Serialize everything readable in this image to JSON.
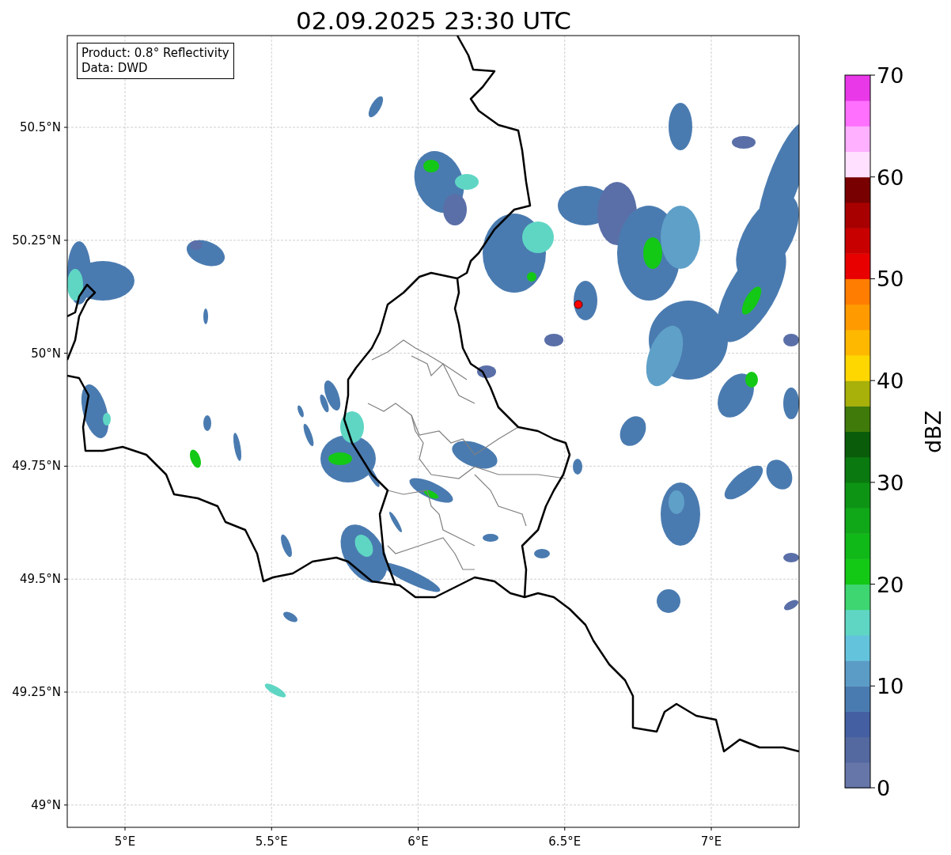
{
  "title": "02.09.2025 23:30 UTC",
  "info_box": {
    "lines": [
      "Product: 0.8° Reflectivity",
      "Data: DWD"
    ]
  },
  "map": {
    "y_ticks": [
      "50.5°N",
      "50.25°N",
      "50°N",
      "49.75°N",
      "49.5°N",
      "49.25°N",
      "49°N"
    ],
    "x_ticks": [
      "5°E",
      "5.5°E",
      "6°E",
      "6.5°E",
      "7°E"
    ]
  },
  "colorbar": {
    "label": "dBZ",
    "ticks": [
      "70",
      "60",
      "50",
      "40",
      "30",
      "20",
      "10",
      "0"
    ],
    "bands": [
      {
        "color": "#6676a8"
      },
      {
        "color": "#5469a0"
      },
      {
        "color": "#4560a2"
      },
      {
        "color": "#4a7bb0"
      },
      {
        "color": "#5b9cc6"
      },
      {
        "color": "#64c3dc"
      },
      {
        "color": "#5fd6c4"
      },
      {
        "color": "#3ed670"
      },
      {
        "color": "#14c816"
      },
      {
        "color": "#10b818"
      },
      {
        "color": "#10a818"
      },
      {
        "color": "#0e9414"
      },
      {
        "color": "#0a7a10"
      },
      {
        "color": "#0a5c0a"
      },
      {
        "color": "#3f7a0a"
      },
      {
        "color": "#a8b00a"
      },
      {
        "color": "#ffd700"
      },
      {
        "color": "#ffb800"
      },
      {
        "color": "#ff9a00"
      },
      {
        "color": "#ff7d00"
      },
      {
        "color": "#e80000"
      },
      {
        "color": "#c80000"
      },
      {
        "color": "#a80000"
      },
      {
        "color": "#780000"
      },
      {
        "color": "#ffe0ff"
      },
      {
        "color": "#ffb0ff"
      },
      {
        "color": "#ff70ff"
      },
      {
        "color": "#e838e8"
      }
    ]
  }
}
